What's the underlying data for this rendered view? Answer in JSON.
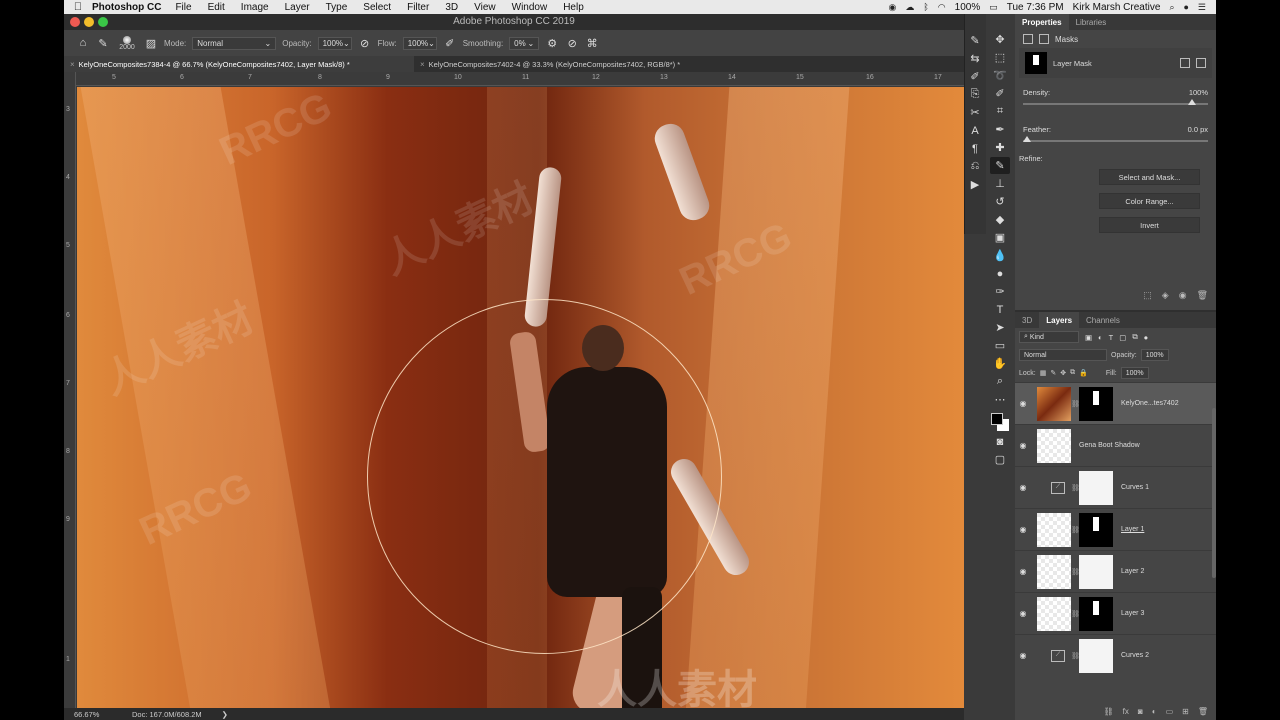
{
  "menubar": {
    "apple": "",
    "app_name": "Photoshop CC",
    "items": [
      "File",
      "Edit",
      "Image",
      "Layer",
      "Type",
      "Select",
      "Filter",
      "3D",
      "View",
      "Window",
      "Help"
    ],
    "battery": "100%",
    "clock": "Tue 7:36 PM",
    "user": "Kirk Marsh Creative"
  },
  "window": {
    "title": "Adobe Photoshop CC 2019"
  },
  "options": {
    "brush_size": "2000",
    "mode_label": "Mode:",
    "mode_value": "Normal",
    "opacity_label": "Opacity:",
    "opacity_value": "100%",
    "flow_label": "Flow:",
    "flow_value": "100%",
    "smoothing_label": "Smoothing:",
    "smoothing_value": "0%"
  },
  "tabs": [
    {
      "label": "KelyOneComposites7384-4 @ 66.7% (KelyOneComposites7402, Layer Mask/8) *"
    },
    {
      "label": "KelyOneComposites7402-4 @ 33.3% (KelyOneComposites7402, RGB/8*) *"
    }
  ],
  "ruler": {
    "h": [
      "5",
      "6",
      "7",
      "8",
      "9",
      "10",
      "11",
      "12",
      "13",
      "14",
      "15",
      "16",
      "17"
    ],
    "v": [
      "3",
      "4",
      "5",
      "6",
      "7",
      "8",
      "9",
      "1"
    ]
  },
  "status": {
    "zoom": "66.67%",
    "doc": "Doc: 167.0M/608.2M",
    "arrow": "❯"
  },
  "watermarks": [
    "RRCG",
    "人人素材",
    "RRCG",
    "人人素材",
    "RRCG",
    "人人素材"
  ],
  "properties": {
    "tab_properties": "Properties",
    "tab_libraries": "Libraries",
    "masks_label": "Masks",
    "layer_mask_label": "Layer Mask",
    "density_label": "Density:",
    "density_value": "100%",
    "density_level": 1.0,
    "feather_label": "Feather:",
    "feather_value": "0.0 px",
    "feather_level": 0.0,
    "refine_label": "Refine:",
    "btn_select_mask": "Select and Mask...",
    "btn_color_range": "Color Range...",
    "btn_invert": "Invert"
  },
  "layers_panel": {
    "tab_3d": "3D",
    "tab_layers": "Layers",
    "tab_channels": "Channels",
    "kind_label": "Kind",
    "blend_mode": "Normal",
    "opacity_label": "Opacity:",
    "opacity_value": "100%",
    "lock_label": "Lock:",
    "fill_label": "Fill:",
    "fill_value": "100%",
    "layers": [
      {
        "name": "KelyOne...tes7402",
        "type": "photo-mask",
        "selected": true
      },
      {
        "name": "Gena Boot Shadow",
        "type": "plain",
        "selected": false
      },
      {
        "name": "Curves 1",
        "type": "adjustment",
        "selected": false
      },
      {
        "name": "Layer 1",
        "type": "mask",
        "selected": false
      },
      {
        "name": "Layer 2",
        "type": "mask",
        "selected": false
      },
      {
        "name": "Layer 3",
        "type": "mask",
        "selected": false
      },
      {
        "name": "Curves 2",
        "type": "adjustment",
        "selected": false
      }
    ]
  },
  "icons": {
    "tools": [
      "move-icon",
      "marquee-icon",
      "lasso-icon",
      "quick-select-icon",
      "crop-icon",
      "eyedropper-icon",
      "healing-icon",
      "brush-icon",
      "stamp-icon",
      "history-brush-icon",
      "eraser-icon",
      "gradient-icon",
      "blur-icon",
      "dodge-icon",
      "pen-icon",
      "type-icon",
      "path-select-icon",
      "shape-icon",
      "hand-icon",
      "zoom-icon"
    ]
  },
  "colors": {
    "accent": "#e08a3c",
    "panel": "#454545"
  }
}
